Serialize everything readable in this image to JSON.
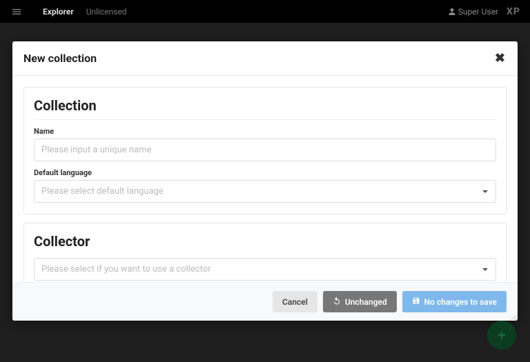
{
  "topbar": {
    "title": "Explorer",
    "status": "Unlicensed",
    "user": "Super User",
    "logo": "XP"
  },
  "modal": {
    "title": "New collection",
    "collection_section": {
      "title": "Collection",
      "name_label": "Name",
      "name_placeholder": "Please input a unique name",
      "lang_label": "Default language",
      "lang_placeholder": "Please select default language"
    },
    "collector_section": {
      "title": "Collector",
      "placeholder": "Please select if you want to use a collector"
    },
    "footer": {
      "cancel": "Cancel",
      "unchanged": "Unchanged",
      "save": "No changes to save"
    }
  }
}
